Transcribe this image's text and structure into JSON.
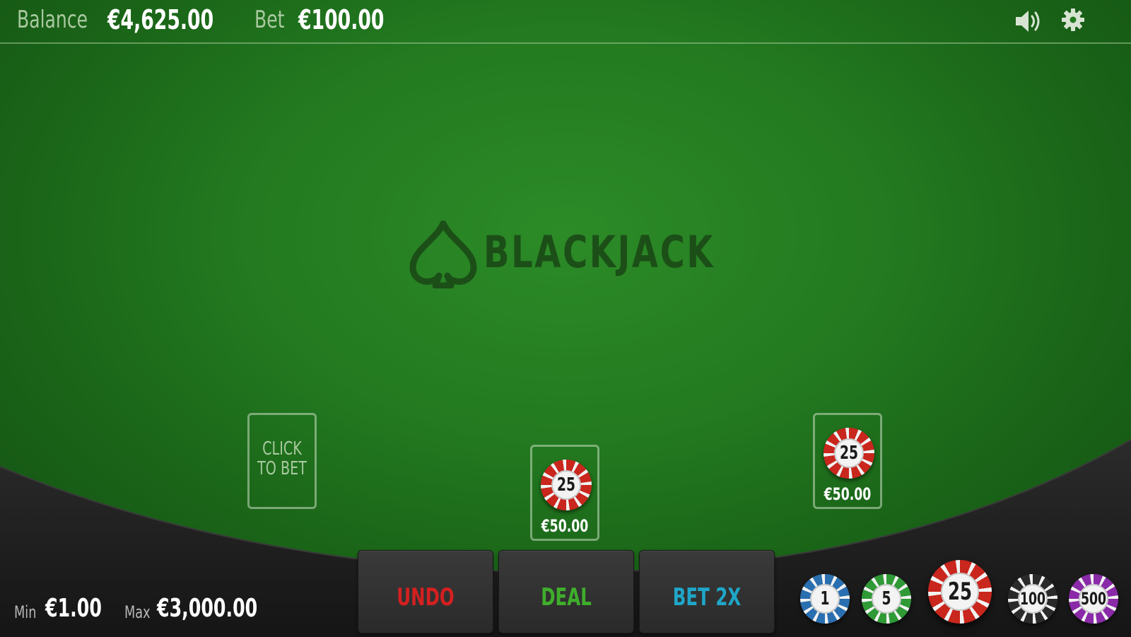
{
  "header": {
    "balance_label": "Balance",
    "balance_value": "€4,625.00",
    "bet_label": "Bet",
    "bet_value": "€100.00",
    "sound_icon": "speaker-volume-icon",
    "settings_icon": "gear-icon"
  },
  "table": {
    "logo_text": "BLACKJACK",
    "logo_icon": "spade-icon",
    "colors": {
      "felt": "#237a20",
      "logo": "#1c4f18",
      "rail": "#1c1c1c"
    }
  },
  "bet_spots": [
    {
      "empty_text_line1": "CLICK",
      "empty_text_line2": "TO BET"
    },
    {
      "chip_value": "25",
      "amount": "€50.00"
    },
    {
      "chip_value": "25",
      "amount": "€50.00"
    }
  ],
  "actions": {
    "undo_label": "UNDO",
    "deal_label": "DEAL",
    "bet2x_label": "BET 2X",
    "colors": {
      "undo": "#d42020",
      "deal": "#3fae2c",
      "bet2x": "#1fa6c8"
    }
  },
  "limits": {
    "min_label": "Min",
    "min_value": "€1.00",
    "max_label": "Max",
    "max_value": "€3,000.00"
  },
  "chip_rack": {
    "chips": [
      {
        "value": "1",
        "color": "#2a6fb0"
      },
      {
        "value": "5",
        "color": "#2f9a36"
      },
      {
        "value": "25",
        "color": "#c9261d",
        "selected": true
      },
      {
        "value": "100",
        "color": "#2a2a2a"
      },
      {
        "value": "500",
        "color": "#8a2aa8"
      }
    ]
  }
}
